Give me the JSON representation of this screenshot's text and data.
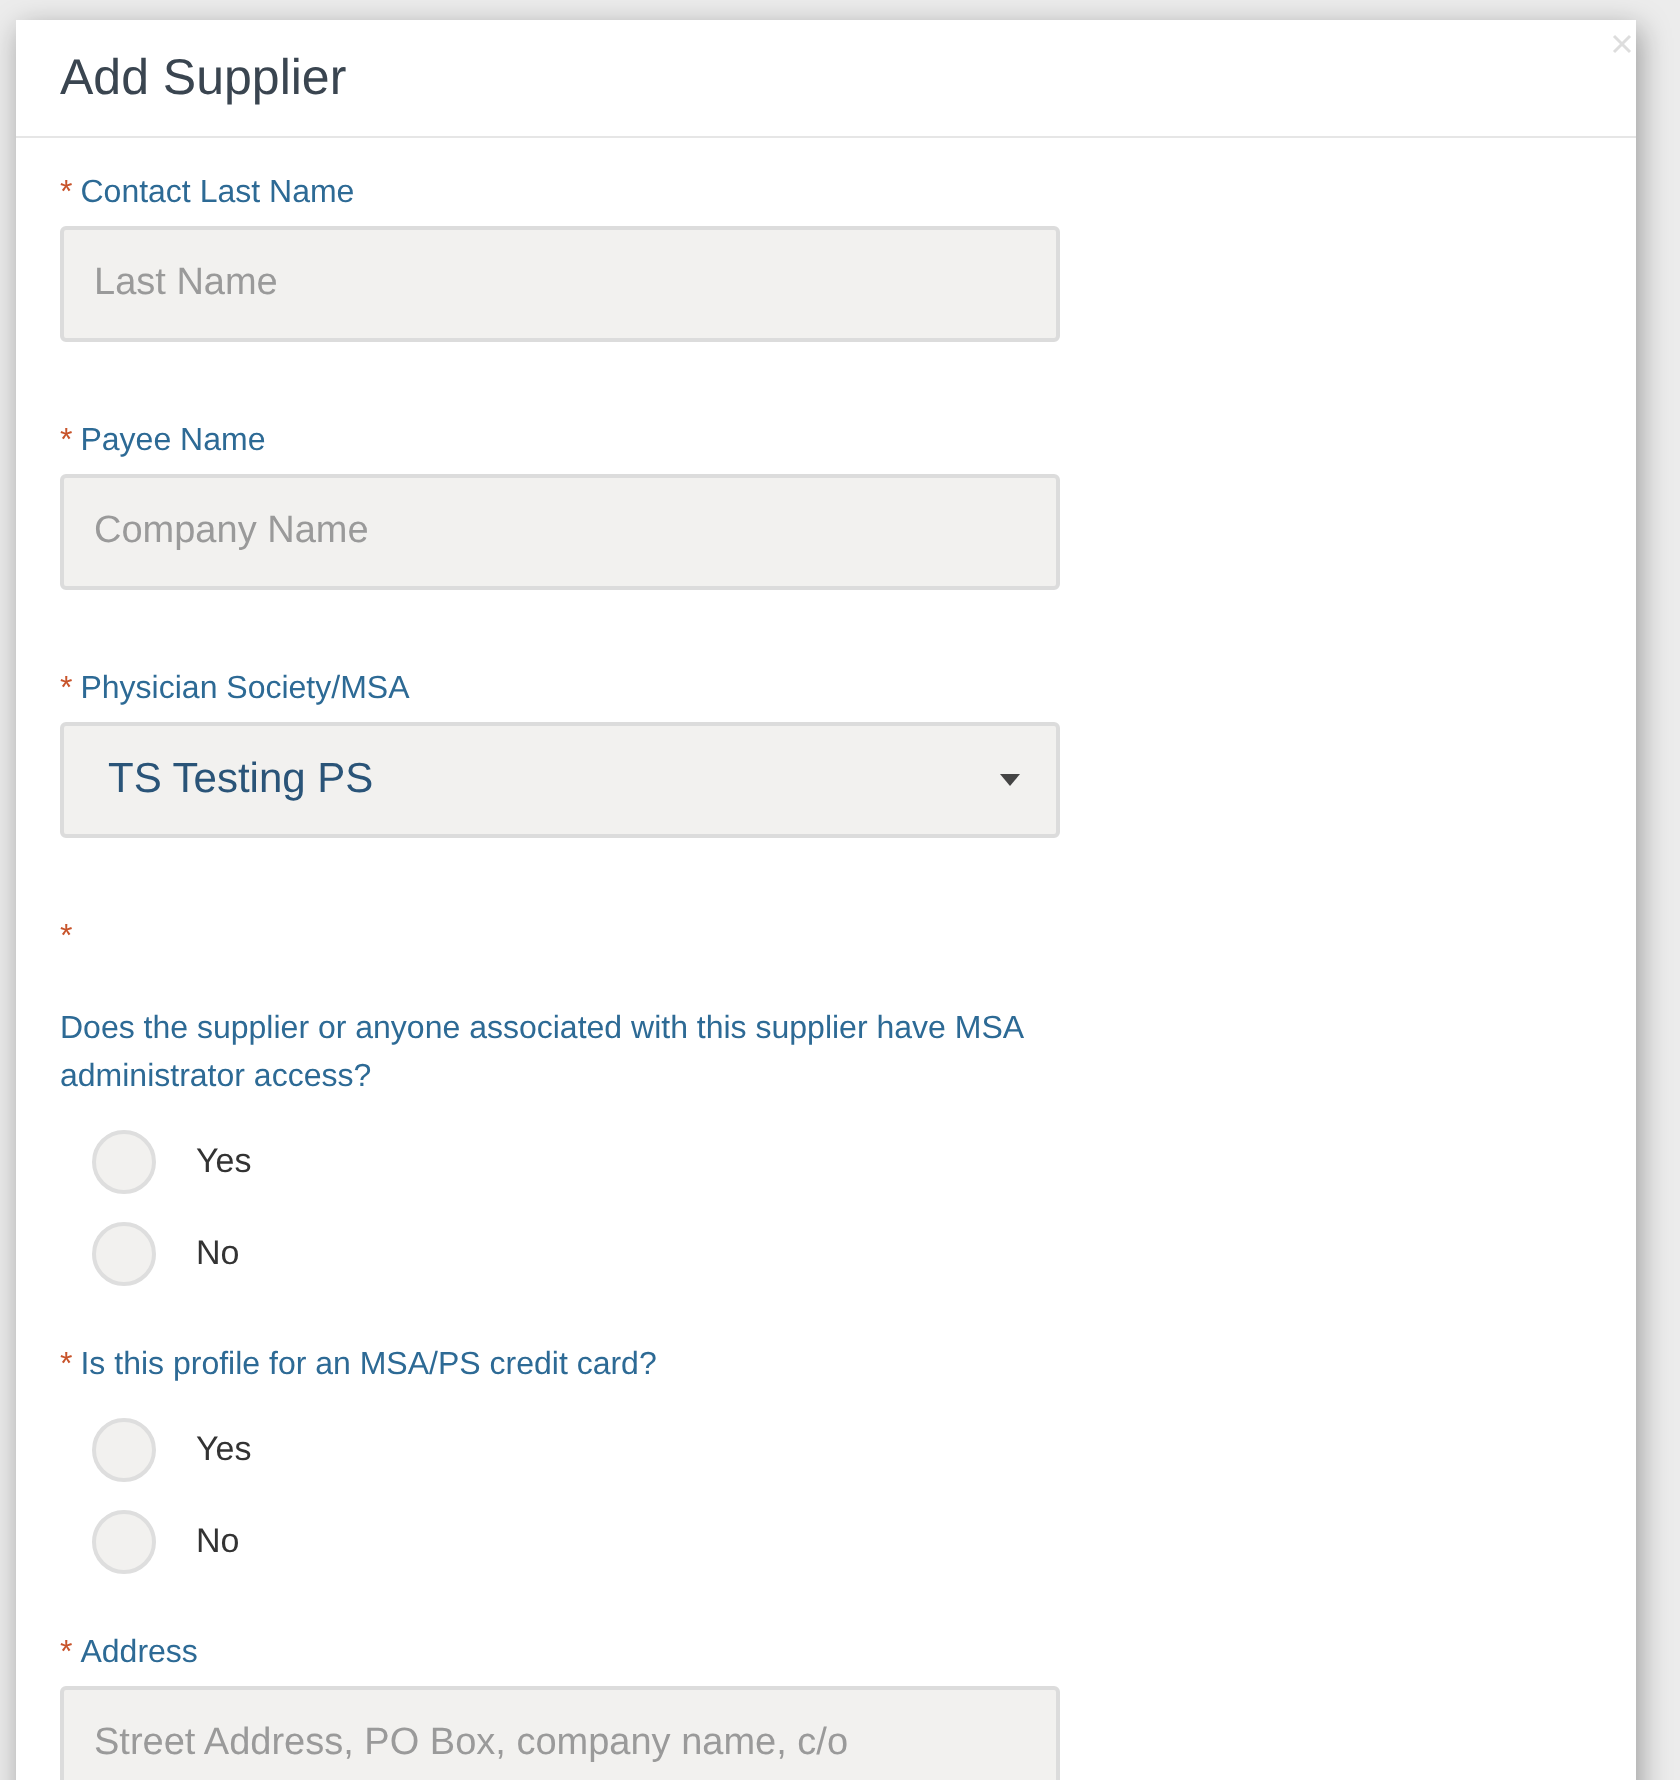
{
  "dialog": {
    "title": "Add Supplier"
  },
  "fields": [
    {
      "kind": "text",
      "label": "Contact Last Name",
      "marker": "*",
      "placeholder": "Last Name"
    },
    {
      "kind": "text",
      "label": "Payee Name",
      "marker": "*",
      "placeholder": "Company Name"
    },
    {
      "kind": "select",
      "label": "Physician Society/MSA",
      "marker": "*",
      "value": "TS Testing PS"
    },
    {
      "kind": "radio",
      "marker_line": "*",
      "label": "Does the supplier or anyone associated with this supplier have MSA administrator access?",
      "options": [
        {
          "label": "Yes",
          "selected": false
        },
        {
          "label": "No",
          "selected": false
        }
      ]
    },
    {
      "kind": "radio",
      "label": "Is this profile for an MSA/PS credit card?",
      "marker": "*",
      "options": [
        {
          "label": "Yes",
          "selected": false
        },
        {
          "label": "No",
          "selected": false
        }
      ]
    },
    {
      "kind": "text",
      "label": "Address",
      "marker": "*",
      "placeholder": "Street Address, PO Box, company name, c/o"
    }
  ]
}
